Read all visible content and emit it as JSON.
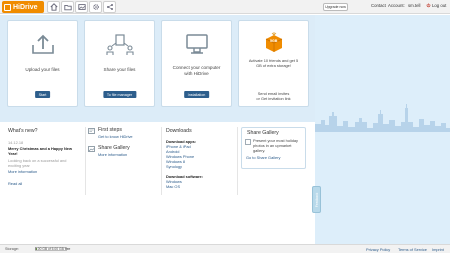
{
  "app": {
    "name": "HiDrive"
  },
  "topbar": {
    "upgrade_label": "Upgrade now",
    "contact_label": "Contact",
    "account_label": "Account:",
    "account_name": "sm.tell",
    "logout_label": "Log out"
  },
  "cards": [
    {
      "title": "Upload your files",
      "button": "Start"
    },
    {
      "title": "Share your files",
      "button": "To file manager"
    },
    {
      "title_line1": "Connect your computer",
      "title_line2": "with HiDrive",
      "button": "Installation"
    },
    {
      "text_line1": "Activate 10 friends and get 5",
      "text_line2": "GB of extra storage!",
      "bottom_line1": "Send email invites",
      "bottom_line2": "or Get invitation link",
      "badge": "5GB"
    }
  ],
  "whats_new": {
    "heading": "What's new?",
    "date": "14.12.18",
    "title_line1": "Merry Christmas and a Happy New",
    "title_line2": "Year!",
    "body_line1": "Looking back on a successful and",
    "body_line2": "exciting year",
    "more": "More information",
    "read_all": "Read all"
  },
  "first_steps": {
    "heading": "First steps",
    "link": "Get to know HiDrive",
    "share_heading": "Share Gallery",
    "share_link": "More information"
  },
  "downloads": {
    "heading": "Downloads",
    "apps_label": "Download apps:",
    "apps": [
      "iPhone & iPad",
      "Android",
      "Windows Phone",
      "Windows 8",
      "Synology"
    ],
    "software_label": "Download software:",
    "software": [
      "Windows",
      "Mac OS"
    ]
  },
  "share_gallery": {
    "heading": "Share Gallery",
    "line1": "Present your most holiday",
    "line2": "photos in an upmarket",
    "line3": "gallery.",
    "link": "Go to Share Gallery"
  },
  "feedback_label": "Feedback",
  "footer": {
    "storage_label": "Storage:",
    "storage_text": "5.00 GB of 5.00 GB free",
    "storage_used_fraction": 0.02,
    "privacy": "Privacy Policy",
    "terms": "Terms of Service",
    "imprint": "Imprint"
  },
  "colors": {
    "brand_orange": "#f08c00",
    "button_blue": "#2d5e8c",
    "band_blue": "#dcecf8"
  }
}
